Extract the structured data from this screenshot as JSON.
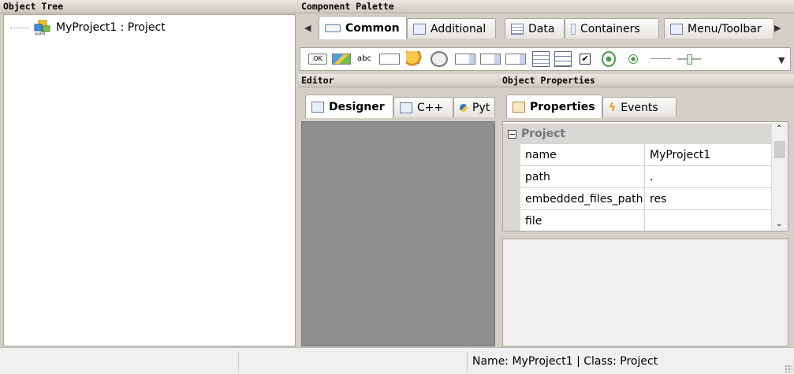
{
  "object_tree": {
    "header": "Object Tree",
    "root_label": "MyProject1 : Project",
    "root_icon": "wxfb-project-icon"
  },
  "component_palette": {
    "header": "Component Palette",
    "tabs": [
      {
        "label": "Common",
        "icon": "ok-button-icon",
        "active": true
      },
      {
        "label": "Additional",
        "icon": "listbox-icon",
        "active": false
      },
      {
        "label": "Data",
        "icon": "grid-icon",
        "active": false
      },
      {
        "label": "Containers",
        "icon": "panel-icon",
        "active": false
      },
      {
        "label": "Menu/Toolbar",
        "icon": "menubar-icon",
        "active": false
      }
    ],
    "widgets": [
      "button-widget-icon",
      "bitmap-button-icon",
      "static-text-icon",
      "text-ctrl-icon",
      "static-bitmap-icon",
      "combo-box-icon",
      "bitmap-combo-icon",
      "choice-icon",
      "list-box-icon",
      "list-ctrl-icon",
      "check-box-icon",
      "radio-box-icon",
      "radio-button-icon",
      "static-line-icon",
      "slider-icon",
      "gauge-icon"
    ],
    "static_text_label": "abc",
    "ok_label": "OK"
  },
  "editor": {
    "header": "Editor",
    "tabs": [
      {
        "label": "Designer",
        "active": true
      },
      {
        "label": "C++",
        "active": false
      },
      {
        "label": "Pyt",
        "active": false
      }
    ]
  },
  "object_properties": {
    "header": "Object Properties",
    "tabs": [
      {
        "label": "Properties",
        "active": true
      },
      {
        "label": "Events",
        "active": false
      }
    ],
    "category": "Project",
    "collapse_glyph": "−",
    "rows": [
      {
        "name": "name",
        "value": "MyProject1"
      },
      {
        "name": "path",
        "value": "."
      },
      {
        "name": "embedded_files_path",
        "value": "res"
      },
      {
        "name": "file",
        "value": ""
      }
    ]
  },
  "status_bar": {
    "text": "Name: MyProject1 | Class: Project"
  },
  "colors": {
    "frame": "#d4d0c8",
    "canvas": "#8e8e8e",
    "category_bg": "#d8d7d3",
    "category_text": "#777777"
  }
}
